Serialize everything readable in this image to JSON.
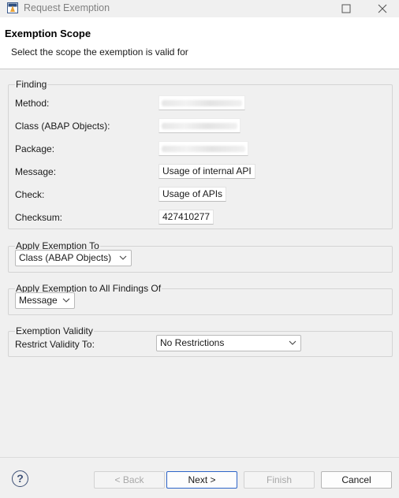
{
  "window": {
    "title": "Request Exemption",
    "icon": "abap-exemption-app-icon",
    "controls": [
      "maximize-icon",
      "close-icon"
    ]
  },
  "header": {
    "title": "Exemption Scope",
    "description": "Select the scope the exemption is valid for"
  },
  "finding": {
    "legend": "Finding",
    "method_label": "Method:",
    "class_label": "Class (ABAP Objects):",
    "package_label": "Package:",
    "message_label": "Message:",
    "message_value": "Usage of internal API",
    "check_label": "Check:",
    "check_value": "Usage of APIs",
    "checksum_label": "Checksum:",
    "checksum_value": "427410277"
  },
  "apply_to": {
    "legend": "Apply Exemption To",
    "selected": "Class (ABAP Objects)"
  },
  "apply_all": {
    "legend": "Apply Exemption to All Findings Of",
    "selected": "Message"
  },
  "validity": {
    "legend": "Exemption Validity",
    "label": "Restrict Validity To:",
    "selected": "No Restrictions"
  },
  "footer": {
    "help_symbol": "?",
    "back_label": "< Back",
    "next_label": "Next >",
    "finish_label": "Finish",
    "cancel_label": "Cancel"
  },
  "colors": {
    "accent": "#2d64c8",
    "help_icon": "#3c4f75"
  }
}
